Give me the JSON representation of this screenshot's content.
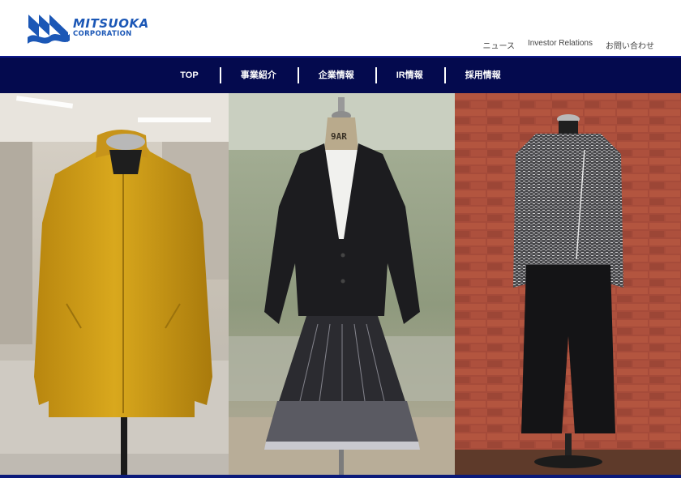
{
  "brand": {
    "name": "MITSUOKA",
    "subtitle": "CORPORATION",
    "color": "#1b57b6"
  },
  "utility_nav": [
    {
      "label": "ニュース"
    },
    {
      "label": "Investor Relations"
    },
    {
      "label": "お問い合わせ"
    }
  ],
  "main_nav": [
    {
      "label": "TOP"
    },
    {
      "label": "事業紹介"
    },
    {
      "label": "企業情報"
    },
    {
      "label": "IR情報"
    },
    {
      "label": "採用情報"
    }
  ],
  "hero": {
    "panels": [
      {
        "subject": "yellow-coat-on-mannequin"
      },
      {
        "subject": "black-jacket-and-skirt-on-dress-form",
        "tag": "9AR"
      },
      {
        "subject": "tweed-jacket-on-mannequin"
      }
    ]
  },
  "colors": {
    "nav_background": "#040a4e",
    "accent": "#1b57b6"
  }
}
